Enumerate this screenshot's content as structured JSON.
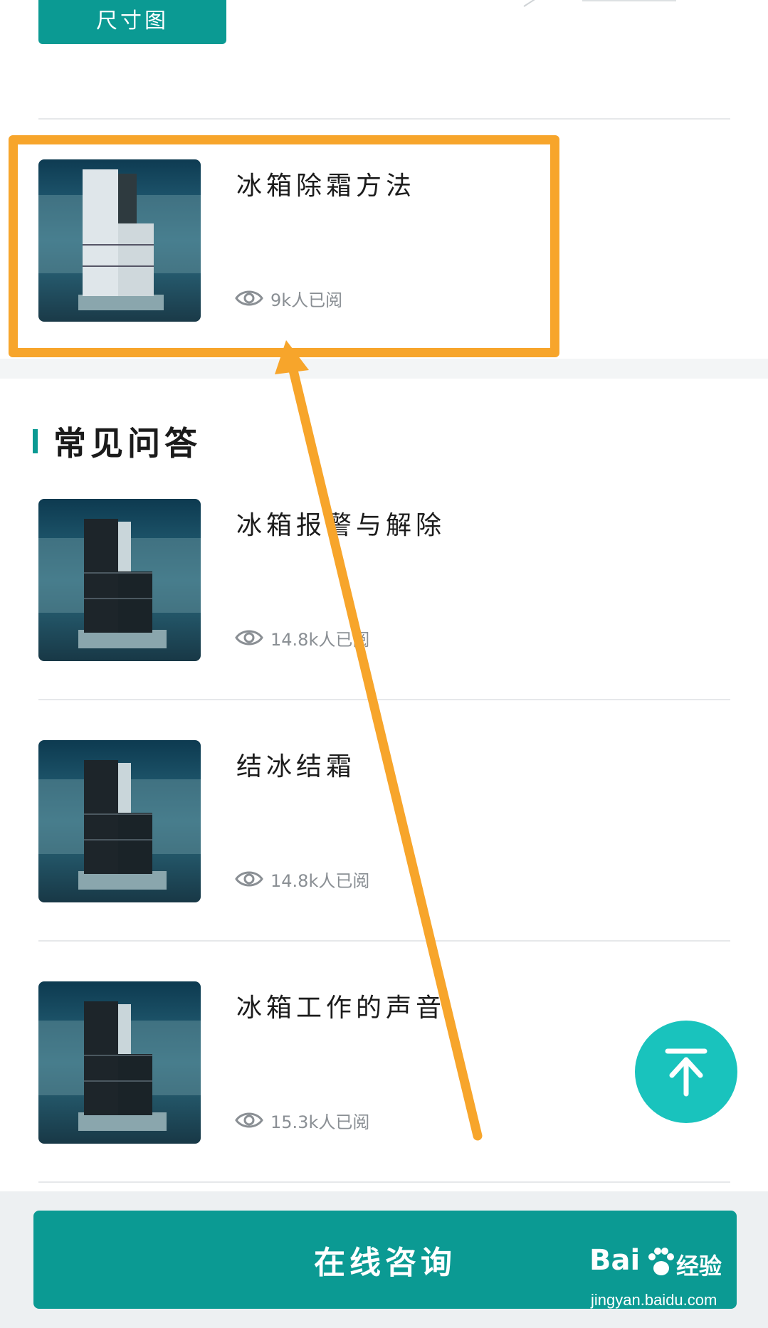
{
  "top": {
    "size_chart_label": "尺寸图"
  },
  "featured_article": {
    "title": "冰箱除霜方法",
    "views": "9k人已阅"
  },
  "faq": {
    "section_title": "常见问答",
    "items": [
      {
        "title": "冰箱报警与解除",
        "views": "14.8k人已阅"
      },
      {
        "title": "结冰结霜",
        "views": "14.8k人已阅"
      },
      {
        "title": "冰箱工作的声音",
        "views": "15.3k人已阅"
      }
    ]
  },
  "bottom": {
    "consult_label": "在线咨询"
  },
  "watermark": {
    "brand": "Bai",
    "brand_cn": "经验",
    "url": "jingyan.baidu.com"
  },
  "colors": {
    "accent": "#0b9a93",
    "back_to_top": "#19c3bd",
    "annotation": "#f7a52b"
  },
  "icons": [
    "eye-icon",
    "arrow-up-icon",
    "fridge-thumbnail"
  ]
}
